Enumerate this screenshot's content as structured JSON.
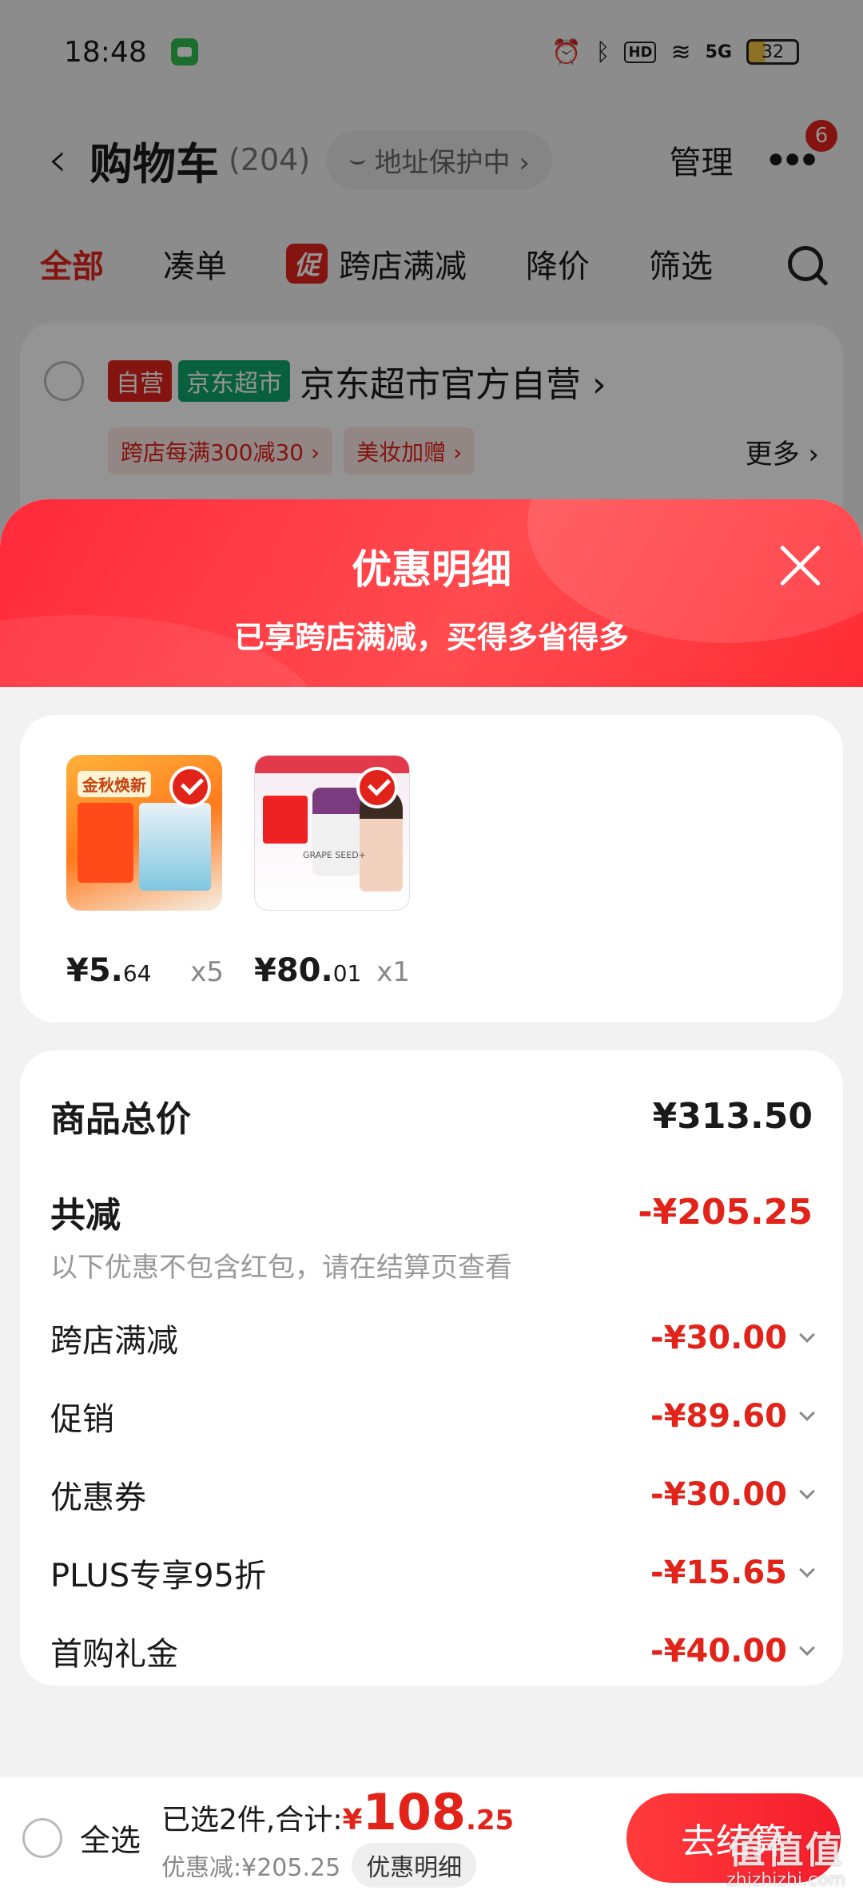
{
  "status_bar": {
    "time": "18:48",
    "network": "5G",
    "battery": "32",
    "hd": "HD"
  },
  "nav": {
    "title": "购物车",
    "count": "(204)",
    "address_protect": "地址保护中 ›",
    "manage": "管理",
    "more_badge": "6"
  },
  "filter_tabs": [
    {
      "label": "全部",
      "active": true
    },
    {
      "label": "凑单"
    },
    {
      "label": "跨店满减",
      "tag": "促"
    },
    {
      "label": "降价"
    },
    {
      "label": "筛选"
    }
  ],
  "store": {
    "badge_self": "自营",
    "badge_market": "京东超市",
    "name": "京东超市官方自营 ›",
    "promos": [
      "跨店每满300减30 ›",
      "美妆加赠 ›"
    ],
    "more": "更多 ›"
  },
  "sheet": {
    "title": "优惠明细",
    "subtitle": "已享跨店满减，买得多省得多",
    "products": [
      {
        "price_int": "¥5.",
        "price_dec": "64",
        "qty": "x5"
      },
      {
        "price_int": "¥80.",
        "price_dec": "01",
        "qty": "x1"
      }
    ],
    "thumb_text": {
      "p1_label": "金秋焕新",
      "p2_label": "GRAPE SEED+"
    },
    "summary": {
      "total_label": "商品总价",
      "total_value": "¥313.50",
      "reduce_label": "共减",
      "reduce_value": "-¥205.25",
      "note": "以下优惠不包含红包，请在结算页查看",
      "discounts": [
        {
          "label": "跨店满减",
          "value": "-¥30.00"
        },
        {
          "label": "促销",
          "value": "-¥89.60"
        },
        {
          "label": "优惠券",
          "value": "-¥30.00"
        },
        {
          "label": "PLUS专享95折",
          "value": "-¥15.65"
        },
        {
          "label": "首购礼金",
          "value": "-¥40.00"
        }
      ]
    }
  },
  "bottom_bar": {
    "select_all": "全选",
    "selected_text": "已选2件,合计:",
    "currency": "¥",
    "total_int": "108",
    "total_dec": ".25",
    "saved": "优惠减:¥205.25",
    "detail_chip": "优惠明细",
    "checkout": "去结算"
  },
  "watermark": {
    "logo": "值值值",
    "site": "zhizhizhi.com"
  },
  "colors": {
    "accent": "#e2231a",
    "header_red": "#ff3a40",
    "green": "#0ea66b"
  }
}
